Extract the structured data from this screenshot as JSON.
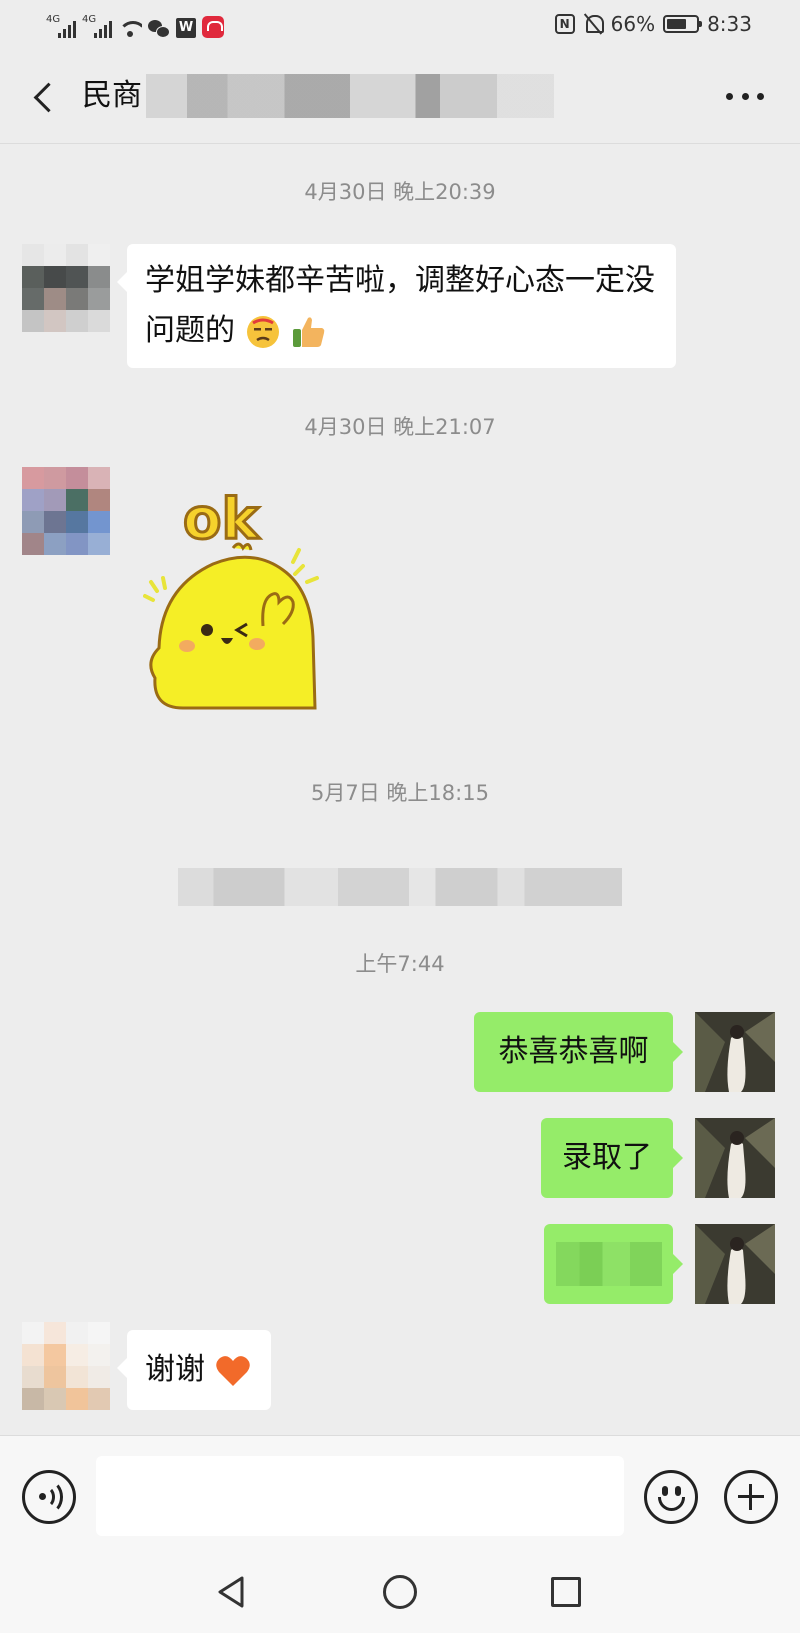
{
  "status_bar": {
    "signal1_label": "4G",
    "signal2_label": "4G",
    "battery_percent": "66%",
    "battery_level": 0.66,
    "time": "8:33",
    "icons": [
      "signal-icon",
      "signal-icon",
      "wifi-icon",
      "wechat-icon",
      "wps-icon",
      "huawei-icon",
      "nfc-icon",
      "bell-off-icon",
      "battery-icon"
    ]
  },
  "header": {
    "title": "民商",
    "back_icon": "chevron-left-icon",
    "more_icon": "more-icon"
  },
  "messages": {
    "ts1": "4月30日 晚上20:39",
    "msg1": "学姐学妹都辛苦啦，调整好心态一定没问题的",
    "msg1_emojis": [
      "😓",
      "👍"
    ],
    "ts2": "4月30日 晚上21:07",
    "sticker_text": "ok",
    "ts3": "5月7日 晚上18:15",
    "ts4": "上午7:44",
    "out1": "恭喜恭喜啊",
    "out2": "录取了",
    "reply": "谢谢",
    "reply_emoji": "❤"
  },
  "input_bar": {
    "placeholder": "",
    "voice_icon": "voice-icon",
    "emoji_icon": "emoji-icon",
    "plus_icon": "plus-icon"
  },
  "nav_bar": {
    "icons": [
      "back-triangle-icon",
      "home-circle-icon",
      "recent-square-icon"
    ]
  },
  "colors": {
    "background": "#ededed",
    "outgoing_bubble": "#95ec69",
    "incoming_bubble": "#ffffff",
    "timestamp": "#8c8c8c"
  }
}
